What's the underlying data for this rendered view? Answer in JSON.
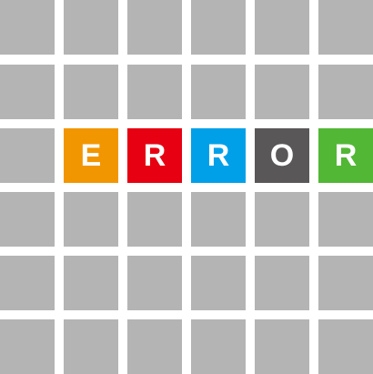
{
  "colors": {
    "background": "#ffffff",
    "empty_tile": "#b4b4b4",
    "letter": "#ffffff"
  },
  "grid": {
    "rows": [
      [
        {
          "text": "",
          "color": "#b4b4b4"
        },
        {
          "text": "",
          "color": "#b4b4b4"
        },
        {
          "text": "",
          "color": "#b4b4b4"
        },
        {
          "text": "",
          "color": "#b4b4b4"
        },
        {
          "text": "",
          "color": "#b4b4b4"
        },
        {
          "text": "",
          "color": "#b4b4b4"
        }
      ],
      [
        {
          "text": "",
          "color": "#b4b4b4"
        },
        {
          "text": "",
          "color": "#b4b4b4"
        },
        {
          "text": "",
          "color": "#b4b4b4"
        },
        {
          "text": "",
          "color": "#b4b4b4"
        },
        {
          "text": "",
          "color": "#b4b4b4"
        },
        {
          "text": "",
          "color": "#b4b4b4"
        }
      ],
      [
        {
          "text": "",
          "color": "#b4b4b4"
        },
        {
          "text": "E",
          "color": "#f29600"
        },
        {
          "text": "R",
          "color": "#e60012"
        },
        {
          "text": "R",
          "color": "#00a0e9"
        },
        {
          "text": "O",
          "color": "#595757"
        },
        {
          "text": "R",
          "color": "#52b735"
        }
      ],
      [
        {
          "text": "",
          "color": "#b4b4b4"
        },
        {
          "text": "",
          "color": "#b4b4b4"
        },
        {
          "text": "",
          "color": "#b4b4b4"
        },
        {
          "text": "",
          "color": "#b4b4b4"
        },
        {
          "text": "",
          "color": "#b4b4b4"
        },
        {
          "text": "",
          "color": "#b4b4b4"
        }
      ],
      [
        {
          "text": "",
          "color": "#b4b4b4"
        },
        {
          "text": "",
          "color": "#b4b4b4"
        },
        {
          "text": "",
          "color": "#b4b4b4"
        },
        {
          "text": "",
          "color": "#b4b4b4"
        },
        {
          "text": "",
          "color": "#b4b4b4"
        },
        {
          "text": "",
          "color": "#b4b4b4"
        }
      ],
      [
        {
          "text": "",
          "color": "#b4b4b4"
        },
        {
          "text": "",
          "color": "#b4b4b4"
        },
        {
          "text": "",
          "color": "#b4b4b4"
        },
        {
          "text": "",
          "color": "#b4b4b4"
        },
        {
          "text": "",
          "color": "#b4b4b4"
        },
        {
          "text": "",
          "color": "#b4b4b4"
        }
      ]
    ]
  }
}
